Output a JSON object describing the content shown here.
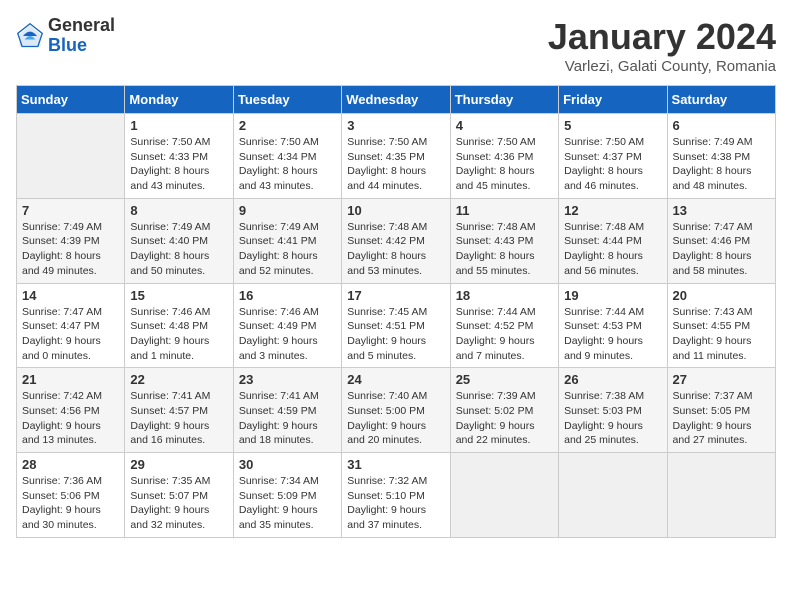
{
  "header": {
    "logo_general": "General",
    "logo_blue": "Blue",
    "month_title": "January 2024",
    "subtitle": "Varlezi, Galati County, Romania"
  },
  "columns": [
    "Sunday",
    "Monday",
    "Tuesday",
    "Wednesday",
    "Thursday",
    "Friday",
    "Saturday"
  ],
  "weeks": [
    [
      {
        "date": "",
        "info": ""
      },
      {
        "date": "1",
        "info": "Sunrise: 7:50 AM\nSunset: 4:33 PM\nDaylight: 8 hours\nand 43 minutes."
      },
      {
        "date": "2",
        "info": "Sunrise: 7:50 AM\nSunset: 4:34 PM\nDaylight: 8 hours\nand 43 minutes."
      },
      {
        "date": "3",
        "info": "Sunrise: 7:50 AM\nSunset: 4:35 PM\nDaylight: 8 hours\nand 44 minutes."
      },
      {
        "date": "4",
        "info": "Sunrise: 7:50 AM\nSunset: 4:36 PM\nDaylight: 8 hours\nand 45 minutes."
      },
      {
        "date": "5",
        "info": "Sunrise: 7:50 AM\nSunset: 4:37 PM\nDaylight: 8 hours\nand 46 minutes."
      },
      {
        "date": "6",
        "info": "Sunrise: 7:49 AM\nSunset: 4:38 PM\nDaylight: 8 hours\nand 48 minutes."
      }
    ],
    [
      {
        "date": "7",
        "info": "Sunrise: 7:49 AM\nSunset: 4:39 PM\nDaylight: 8 hours\nand 49 minutes."
      },
      {
        "date": "8",
        "info": "Sunrise: 7:49 AM\nSunset: 4:40 PM\nDaylight: 8 hours\nand 50 minutes."
      },
      {
        "date": "9",
        "info": "Sunrise: 7:49 AM\nSunset: 4:41 PM\nDaylight: 8 hours\nand 52 minutes."
      },
      {
        "date": "10",
        "info": "Sunrise: 7:48 AM\nSunset: 4:42 PM\nDaylight: 8 hours\nand 53 minutes."
      },
      {
        "date": "11",
        "info": "Sunrise: 7:48 AM\nSunset: 4:43 PM\nDaylight: 8 hours\nand 55 minutes."
      },
      {
        "date": "12",
        "info": "Sunrise: 7:48 AM\nSunset: 4:44 PM\nDaylight: 8 hours\nand 56 minutes."
      },
      {
        "date": "13",
        "info": "Sunrise: 7:47 AM\nSunset: 4:46 PM\nDaylight: 8 hours\nand 58 minutes."
      }
    ],
    [
      {
        "date": "14",
        "info": "Sunrise: 7:47 AM\nSunset: 4:47 PM\nDaylight: 9 hours\nand 0 minutes."
      },
      {
        "date": "15",
        "info": "Sunrise: 7:46 AM\nSunset: 4:48 PM\nDaylight: 9 hours\nand 1 minute."
      },
      {
        "date": "16",
        "info": "Sunrise: 7:46 AM\nSunset: 4:49 PM\nDaylight: 9 hours\nand 3 minutes."
      },
      {
        "date": "17",
        "info": "Sunrise: 7:45 AM\nSunset: 4:51 PM\nDaylight: 9 hours\nand 5 minutes."
      },
      {
        "date": "18",
        "info": "Sunrise: 7:44 AM\nSunset: 4:52 PM\nDaylight: 9 hours\nand 7 minutes."
      },
      {
        "date": "19",
        "info": "Sunrise: 7:44 AM\nSunset: 4:53 PM\nDaylight: 9 hours\nand 9 minutes."
      },
      {
        "date": "20",
        "info": "Sunrise: 7:43 AM\nSunset: 4:55 PM\nDaylight: 9 hours\nand 11 minutes."
      }
    ],
    [
      {
        "date": "21",
        "info": "Sunrise: 7:42 AM\nSunset: 4:56 PM\nDaylight: 9 hours\nand 13 minutes."
      },
      {
        "date": "22",
        "info": "Sunrise: 7:41 AM\nSunset: 4:57 PM\nDaylight: 9 hours\nand 16 minutes."
      },
      {
        "date": "23",
        "info": "Sunrise: 7:41 AM\nSunset: 4:59 PM\nDaylight: 9 hours\nand 18 minutes."
      },
      {
        "date": "24",
        "info": "Sunrise: 7:40 AM\nSunset: 5:00 PM\nDaylight: 9 hours\nand 20 minutes."
      },
      {
        "date": "25",
        "info": "Sunrise: 7:39 AM\nSunset: 5:02 PM\nDaylight: 9 hours\nand 22 minutes."
      },
      {
        "date": "26",
        "info": "Sunrise: 7:38 AM\nSunset: 5:03 PM\nDaylight: 9 hours\nand 25 minutes."
      },
      {
        "date": "27",
        "info": "Sunrise: 7:37 AM\nSunset: 5:05 PM\nDaylight: 9 hours\nand 27 minutes."
      }
    ],
    [
      {
        "date": "28",
        "info": "Sunrise: 7:36 AM\nSunset: 5:06 PM\nDaylight: 9 hours\nand 30 minutes."
      },
      {
        "date": "29",
        "info": "Sunrise: 7:35 AM\nSunset: 5:07 PM\nDaylight: 9 hours\nand 32 minutes."
      },
      {
        "date": "30",
        "info": "Sunrise: 7:34 AM\nSunset: 5:09 PM\nDaylight: 9 hours\nand 35 minutes."
      },
      {
        "date": "31",
        "info": "Sunrise: 7:32 AM\nSunset: 5:10 PM\nDaylight: 9 hours\nand 37 minutes."
      },
      {
        "date": "",
        "info": ""
      },
      {
        "date": "",
        "info": ""
      },
      {
        "date": "",
        "info": ""
      }
    ]
  ]
}
